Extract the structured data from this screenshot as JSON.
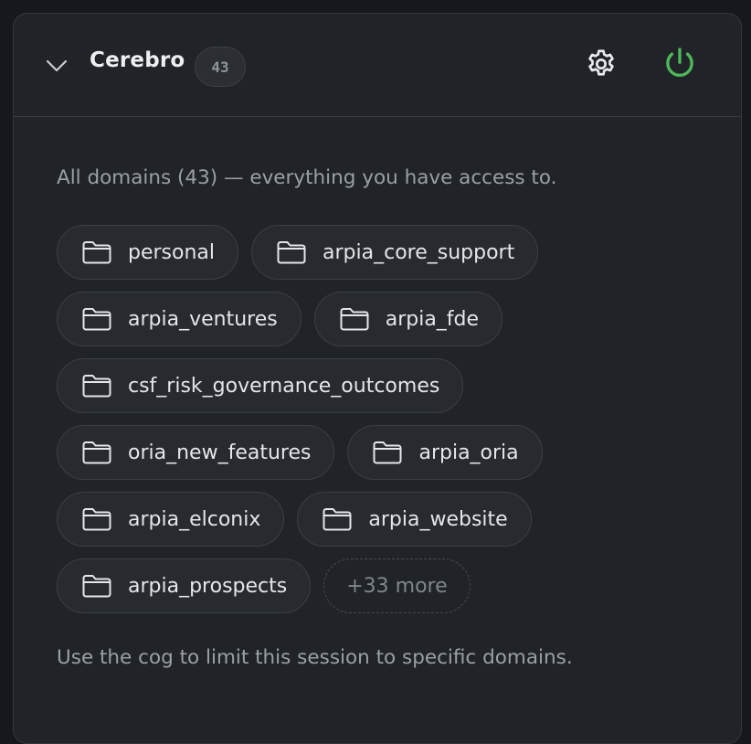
{
  "header": {
    "title": "Cerebro",
    "count": "43",
    "collapse_icon": "chevron-down-icon",
    "settings_icon": "gear-icon",
    "power_icon": "power-icon",
    "power_color": "#4fb85a"
  },
  "body": {
    "description": "All domains (43) — everything you have access to.",
    "domains": [
      "personal",
      "arpia_core_support",
      "arpia_ventures",
      "arpia_fde",
      "csf_risk_governance_outcomes",
      "oria_new_features",
      "arpia_oria",
      "arpia_elconix",
      "arpia_website",
      "arpia_prospects"
    ],
    "domain_icon": "folder-icon",
    "more_label": "+33 more",
    "hint": "Use the cog to limit this session to specific domains."
  }
}
